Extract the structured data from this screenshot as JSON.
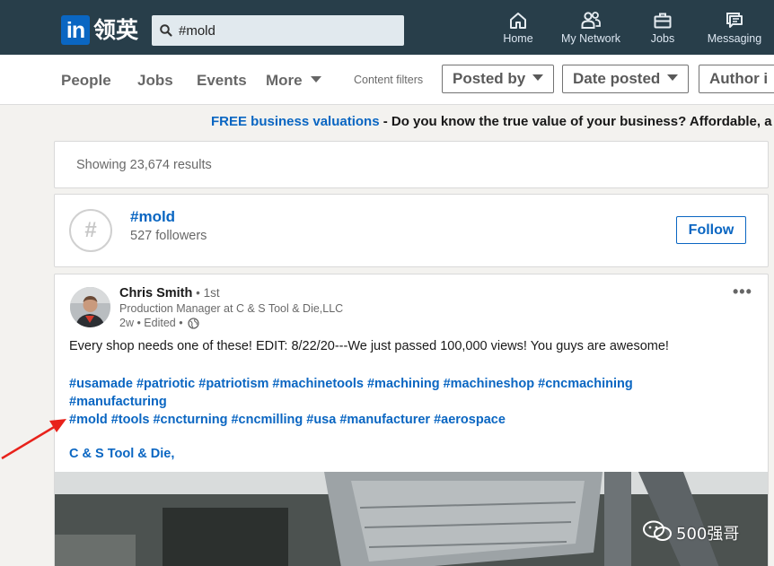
{
  "app": {
    "logo_text": "in",
    "logo_cn": "领英"
  },
  "search": {
    "value": "#mold"
  },
  "nav": {
    "home": "Home",
    "network": "My Network",
    "jobs": "Jobs",
    "messaging": "Messaging"
  },
  "filters": {
    "tabs": [
      "People",
      "Jobs",
      "Events",
      "More"
    ],
    "content_filters": "Content filters",
    "posted_by": "Posted by",
    "date_posted": "Date posted",
    "author": "Author i"
  },
  "ad": {
    "link": "FREE business valuations",
    "text": " - Do you know the true value of your business? Affordable, a"
  },
  "results": {
    "text": "Showing 23,674 results"
  },
  "hashtag": {
    "icon": "#",
    "name": "#mold",
    "followers": "527 followers",
    "follow_label": "Follow"
  },
  "post": {
    "author": "Chris Smith",
    "degree": " • 1st",
    "title": "Production Manager at C & S Tool & Die,LLC",
    "meta": "2w • Edited •",
    "more": "•••",
    "text": "Every shop needs one of these! EDIT: 8/22/20---We just passed 100,000 views! You guys are awesome!",
    "hashtag_lines": [
      "#usamade #patriotic #patriotism #machinetools #machining #machineshop #cncmachining",
      "#manufacturing",
      "#mold #tools #cncturning #cncmilling #usa #manufacturer #aerospace"
    ],
    "company": "C & S Tool & Die,"
  },
  "watermark": {
    "text": "500强哥"
  },
  "colors": {
    "nav_bg": "#283e4a",
    "brand_blue": "#0a66c2",
    "page_bg": "#f3f2ef",
    "annotation_red": "#e8221b"
  }
}
